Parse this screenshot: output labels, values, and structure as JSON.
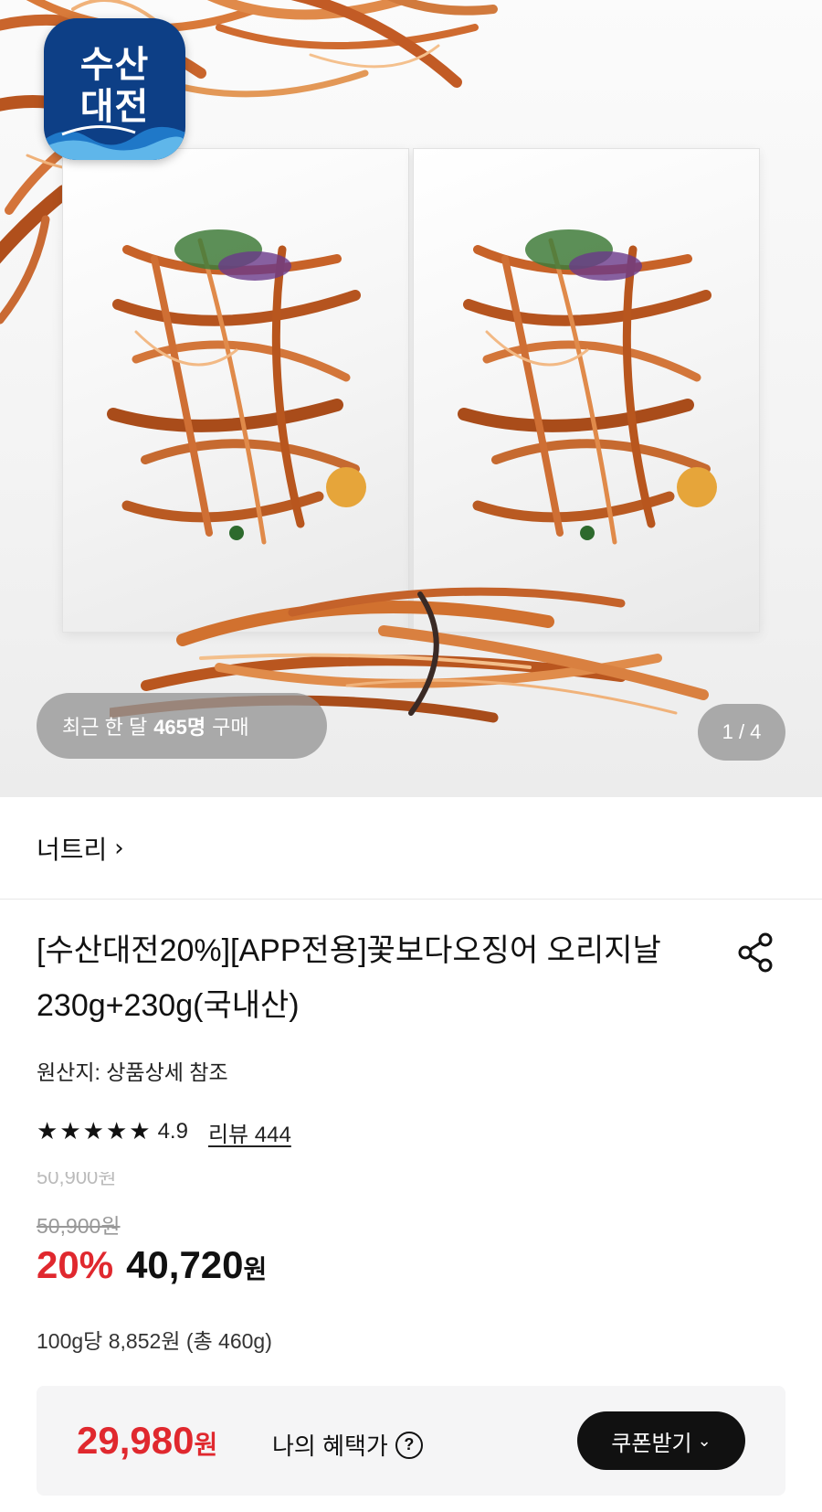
{
  "hero": {
    "app_logo_text_line1": "수산",
    "app_logo_text_line2": "대전",
    "buyers_prefix": "최근 한 달",
    "buyers_count": "465명",
    "buyers_suffix": "구매",
    "image_counter": "1 / 4"
  },
  "store": {
    "name": "너트리",
    "chevron": "›"
  },
  "product": {
    "title": "[수산대전20%][APP전용]꽃보다오징어 오리지날 230g+230g(국내산)",
    "origin": "원산지: 상품상세 참조",
    "rating": "4.9",
    "stars": 5,
    "review_link": "리뷰 444",
    "original_price": "50,900원",
    "discount_rate": "20%",
    "sale_price": "40,720",
    "sale_unit": "원",
    "unit_price": "100g당 8,852원 (총 460g)"
  },
  "benefit": {
    "price": "29,980",
    "unit": "원",
    "label": "나의 혜택가",
    "help_icon": "?",
    "coupon_button": "쿠폰받기",
    "coupon_chevron": "⌄"
  },
  "icons": {
    "share": "share-icon",
    "star": "star-icon",
    "help": "question-circle-icon"
  },
  "colors": {
    "accent_red": "#e0282e",
    "logo_blue": "#0d3f86",
    "button_dark": "#111111"
  }
}
